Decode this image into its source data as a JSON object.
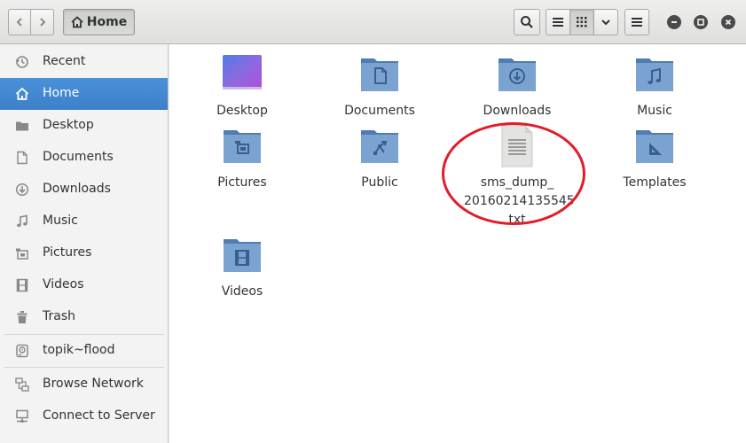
{
  "header": {
    "back_icon": "chevron-left-icon",
    "forward_icon": "chevron-right-icon",
    "path_button_label": "Home",
    "search_icon": "search-icon",
    "list_view_icon": "list-icon",
    "grid_view_icon": "grid-icon",
    "view_options_icon": "chevron-down-icon",
    "menu_icon": "hamburger-icon",
    "minimize_icon": "minimize-icon",
    "maximize_icon": "maximize-icon",
    "close_icon": "close-icon"
  },
  "sidebar": {
    "items": [
      {
        "label": "Recent",
        "icon": "clock-icon"
      },
      {
        "label": "Home",
        "icon": "home-icon",
        "selected": true
      },
      {
        "label": "Desktop",
        "icon": "folder-icon"
      },
      {
        "label": "Documents",
        "icon": "document-icon"
      },
      {
        "label": "Downloads",
        "icon": "download-icon"
      },
      {
        "label": "Music",
        "icon": "music-icon"
      },
      {
        "label": "Pictures",
        "icon": "camera-icon"
      },
      {
        "label": "Videos",
        "icon": "film-icon"
      },
      {
        "label": "Trash",
        "icon": "trash-icon"
      },
      {
        "label": "topik~flood",
        "icon": "drive-icon"
      },
      {
        "label": "Browse Network",
        "icon": "network-icon"
      },
      {
        "label": "Connect to Server",
        "icon": "server-icon"
      }
    ]
  },
  "files": [
    {
      "name": "Desktop",
      "type": "desktop-folder"
    },
    {
      "name": "Documents",
      "type": "documents-folder"
    },
    {
      "name": "Downloads",
      "type": "downloads-folder"
    },
    {
      "name": "Music",
      "type": "music-folder"
    },
    {
      "name": "Pictures",
      "type": "pictures-folder"
    },
    {
      "name": "Public",
      "type": "public-folder"
    },
    {
      "name_lines": [
        "sms_dump_",
        "20160214135545",
        "txt"
      ],
      "type": "text-file"
    },
    {
      "name": "Templates",
      "type": "templates-folder"
    },
    {
      "name": "Videos",
      "type": "videos-folder"
    }
  ],
  "colors": {
    "selection": "#4a90d9",
    "folder": "#6b95c4",
    "annotation": "#e31c28"
  }
}
